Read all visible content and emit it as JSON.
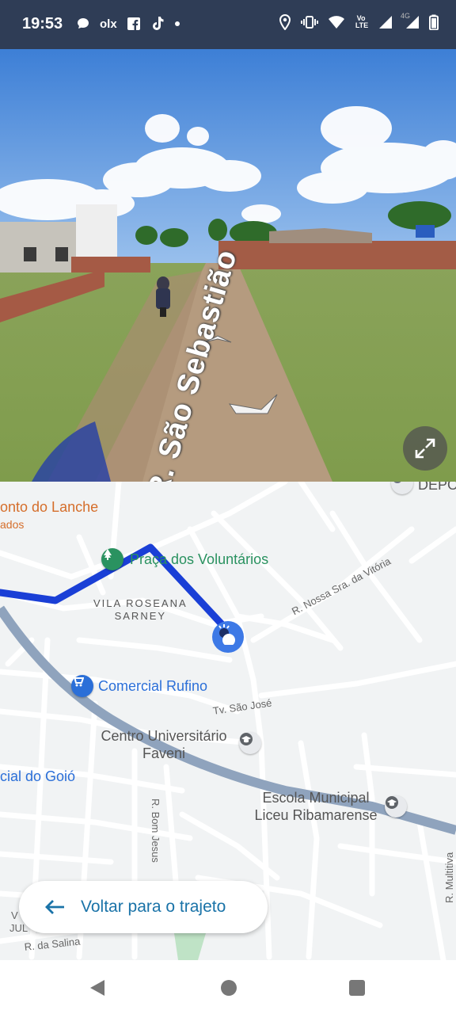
{
  "status_bar": {
    "time": "19:53",
    "left_icons": [
      "chat-bubble-icon",
      "olx-icon",
      "facebook-icon",
      "tiktok-icon",
      "dot-icon"
    ],
    "olx_text": "olx",
    "right_icons": [
      "location-icon",
      "vibrate-icon",
      "wifi-icon",
      "volte-icon",
      "signal-icon",
      "signal-4g-icon",
      "battery-icon"
    ],
    "volte_text": "Vo LTE",
    "network_text": "4G"
  },
  "street_view": {
    "street_label": "R. São Sebastião",
    "expand_icon": "expand-icon"
  },
  "map": {
    "labels": {
      "ponto_lanche": "onto do Lanche",
      "ponto_lanche_sub": "ados",
      "depo": "DEPO",
      "praca": "Praça dos Voluntários",
      "vila_line1": "VILA ROSEANA",
      "vila_line2": "SARNEY",
      "nossa_sra": "R. Nossa Sra. da Vitória",
      "comercial": "Comercial Rufino",
      "tv_sao_jose": "Tv. São José",
      "centro_line1": "Centro Universitário",
      "centro_line2": "Faveni",
      "goio": "cial do Goió",
      "escola_line1": "Escola Municipal",
      "escola_line2": "Liceu Ribamarense",
      "bom_jesus": "R. Bom Jesus",
      "multitiva": "R. Multitiva",
      "salina": "R. da Salina",
      "jul": "JUL",
      "v": "V"
    },
    "colors": {
      "route": "#1a3fd6",
      "main_road": "#8fa3bd",
      "orange_poi": "#d56e2b",
      "green_poi": "#2a9260",
      "blue_poi": "#2b6fd8"
    }
  },
  "back_to_route": {
    "label": "Voltar para o trajeto",
    "icon": "arrow-left-icon"
  },
  "nav_bar": {
    "icons": [
      "back-triangle-icon",
      "home-circle-icon",
      "recents-square-icon"
    ]
  }
}
